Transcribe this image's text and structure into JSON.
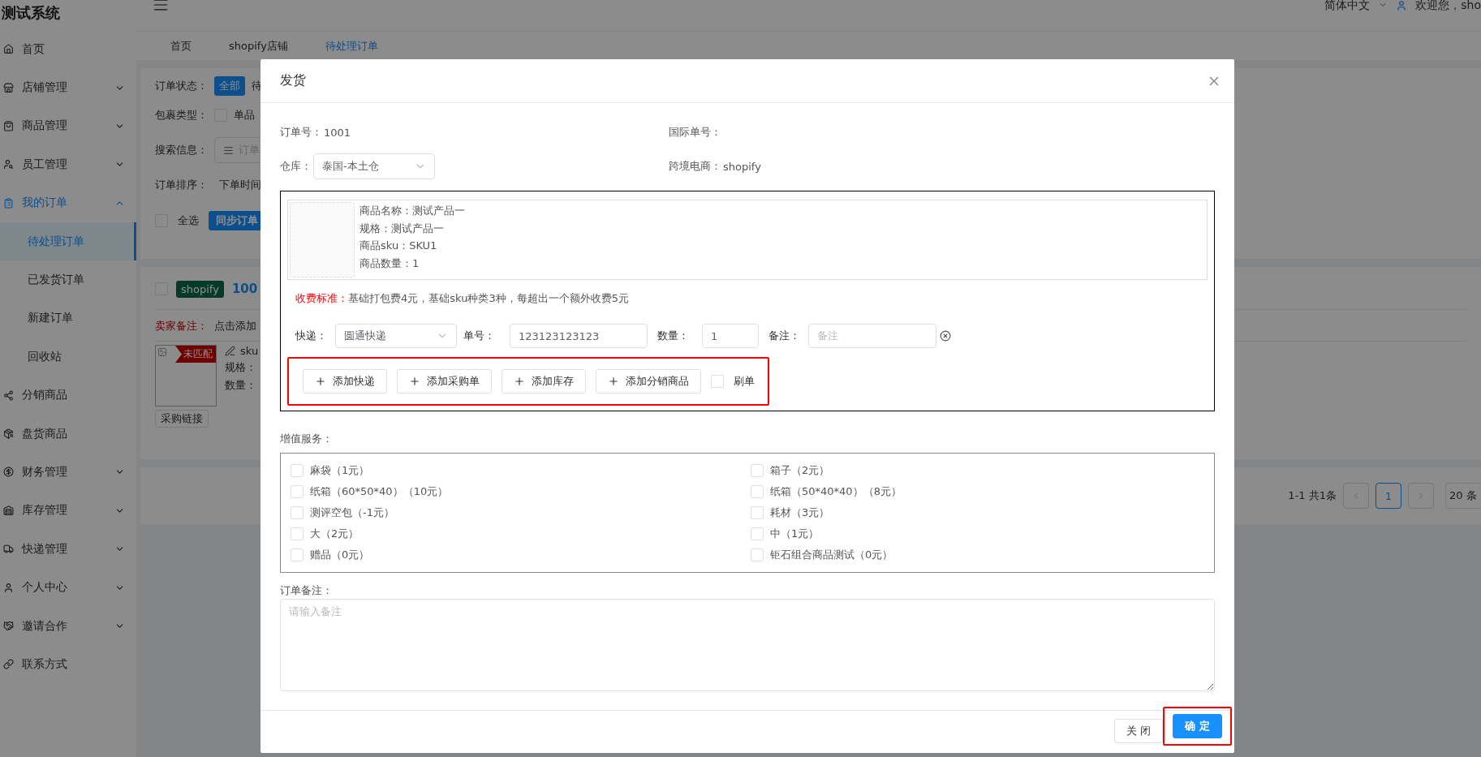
{
  "header": {
    "title": "测试系统",
    "language": "简体中文",
    "welcome": "欢迎您，sho"
  },
  "sidebar": {
    "items": [
      {
        "label": "首页",
        "kind": "link",
        "selected": false
      },
      {
        "label": "店铺管理",
        "kind": "group",
        "selected": false,
        "expanded": false
      },
      {
        "label": "商品管理",
        "kind": "group",
        "selected": false,
        "expanded": false
      },
      {
        "label": "员工管理",
        "kind": "group",
        "selected": false,
        "expanded": false
      },
      {
        "label": "我的订单",
        "kind": "group",
        "selected": false,
        "expanded": true,
        "children": [
          {
            "label": "待处理订单",
            "selected": true
          },
          {
            "label": "已发货订单",
            "selected": false
          },
          {
            "label": "新建订单",
            "selected": false
          },
          {
            "label": "回收站",
            "selected": false
          }
        ]
      },
      {
        "label": "分销商品",
        "kind": "link",
        "selected": false
      },
      {
        "label": "盘货商品",
        "kind": "link",
        "selected": false
      },
      {
        "label": "财务管理",
        "kind": "group",
        "selected": false,
        "expanded": false
      },
      {
        "label": "库存管理",
        "kind": "group",
        "selected": false,
        "expanded": false
      },
      {
        "label": "快递管理",
        "kind": "group",
        "selected": false,
        "expanded": false
      },
      {
        "label": "个人中心",
        "kind": "group",
        "selected": false,
        "expanded": false
      },
      {
        "label": "邀请合作",
        "kind": "group",
        "selected": false,
        "expanded": false
      },
      {
        "label": "联系方式",
        "kind": "link",
        "selected": false
      }
    ]
  },
  "tabs": [
    {
      "label": "首页",
      "selected": false
    },
    {
      "label": "shopify店铺",
      "selected": false
    },
    {
      "label": "待处理订单",
      "selected": true
    }
  ],
  "filter_panel": {
    "status_label": "订单状态：",
    "status_options": [
      {
        "label": "全部",
        "selected": true
      },
      {
        "label": "待",
        "selected": false
      }
    ],
    "package_label": "包裹类型：",
    "package_option": {
      "label": "单品",
      "checked": false
    },
    "search_label": "搜索信息：",
    "search_placeholder": "订单",
    "sort_label": "订单排序：",
    "sort_value": "下单时间",
    "select_all": {
      "label": "全选",
      "checked": false
    },
    "sync_button": "同步订单"
  },
  "order_card": {
    "checked": false,
    "platform": "shopify",
    "order_no": "100",
    "seller_note_label": "卖家备注：",
    "seller_note_action": "点击添加",
    "match_badge": "未匹配",
    "sku_label": "sku",
    "spec_label": "规格：",
    "qty_label": "数量：",
    "purchase_link_button": "采购链接"
  },
  "pagination": {
    "summary": "1-1 共1条",
    "pages": [
      {
        "label": "1",
        "selected": true
      }
    ],
    "page_size": "20 条"
  },
  "dialog": {
    "title": "发货",
    "order_no": {
      "label": "订单号：",
      "value": "1001"
    },
    "intl_no": {
      "label": "国际单号："
    },
    "warehouse": {
      "label": "仓库：",
      "value": "泰国-本土仓"
    },
    "platform": {
      "label": "跨境电商：",
      "value": "shopify"
    },
    "product": {
      "lines": [
        "商品名称：测试产品一",
        "规格：测试产品一",
        "商品sku：SKU1",
        "商品数量：1"
      ]
    },
    "fee": {
      "label": "收费标准：",
      "text": "基础打包费4元，基础sku种类3种，每超出一个额外收费5元"
    },
    "shipment": {
      "carrier": {
        "label": "快递：",
        "value": "圆通快递"
      },
      "tracking": {
        "label": "单号：",
        "value": "123123123123"
      },
      "quantity": {
        "label": "数量：",
        "value": "1"
      },
      "note": {
        "label": "备注：",
        "placeholder": "备注"
      }
    },
    "actions": [
      {
        "label": "添加快递"
      },
      {
        "label": "添加采购单"
      },
      {
        "label": "添加库存"
      },
      {
        "label": "添加分销商品"
      }
    ],
    "brush_order": {
      "label": "刷单",
      "checked": false
    },
    "services": {
      "label": "增值服务：",
      "items": [
        {
          "label": "麻袋（1元）",
          "checked": false
        },
        {
          "label": "箱子（2元）",
          "checked": false
        },
        {
          "label": "纸箱（60*50*40）（10元）",
          "checked": false
        },
        {
          "label": "纸箱（50*40*40）（8元）",
          "checked": false
        },
        {
          "label": "测评空包（-1元）",
          "checked": false
        },
        {
          "label": "耗材（3元）",
          "checked": false
        },
        {
          "label": "大（2元）",
          "checked": false
        },
        {
          "label": "中（1元）",
          "checked": false
        },
        {
          "label": "赠品（0元）",
          "checked": false
        },
        {
          "label": "钜石组合商品测试（0元）",
          "checked": false
        }
      ]
    },
    "order_note": {
      "label": "订单备注：",
      "placeholder": "请输入备注"
    },
    "footer_buttons": [
      {
        "label": "关 闭",
        "kind": "default"
      },
      {
        "label": "确 定",
        "kind": "primary"
      }
    ]
  }
}
